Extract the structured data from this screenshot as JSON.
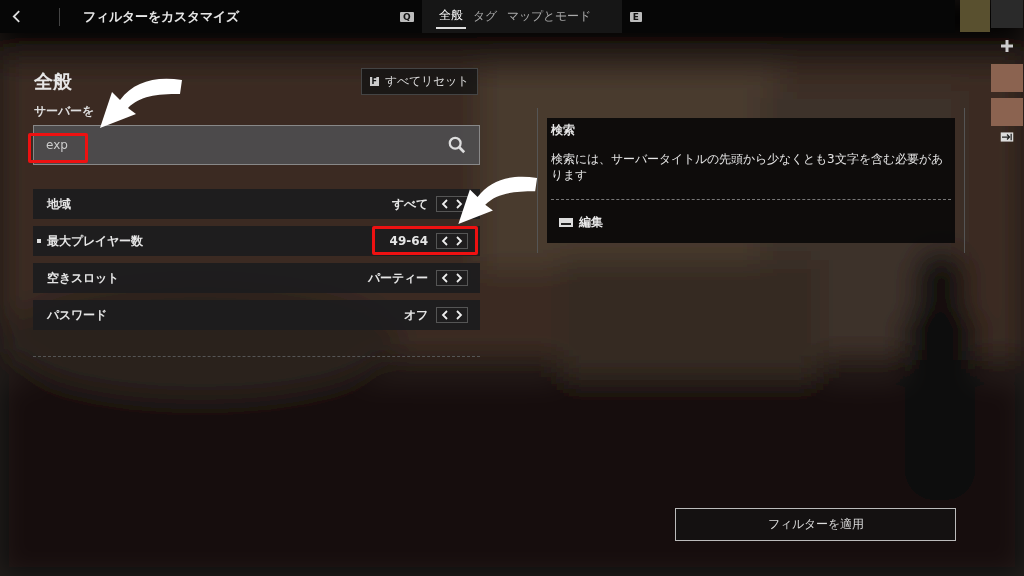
{
  "header": {
    "title": "フィルターをカスタマイズ",
    "prev_key": "Q",
    "next_key": "E"
  },
  "tabs": [
    {
      "label": "全般",
      "selected": true
    },
    {
      "label": "タグ",
      "selected": false
    },
    {
      "label": "マップとモード",
      "selected": false
    }
  ],
  "section": {
    "heading": "全般",
    "reset_key": "F",
    "reset_label": "すべてリセット"
  },
  "search": {
    "label": "サーバーを",
    "value": "exp"
  },
  "filters": [
    {
      "label": "地域",
      "value": "すべて",
      "selected": false
    },
    {
      "label": "最大プレイヤー数",
      "value": "49-64",
      "selected": true
    },
    {
      "label": "空きスロット",
      "value": "パーティー",
      "selected": false
    },
    {
      "label": "パスワード",
      "value": "オフ",
      "selected": false
    }
  ],
  "info": {
    "title": "検索",
    "text": "検索には、サーバータイトルの先頭から少なくとも3文字を含む必要があります",
    "edit_label": "編集"
  },
  "apply_button": "フィルターを適用"
}
